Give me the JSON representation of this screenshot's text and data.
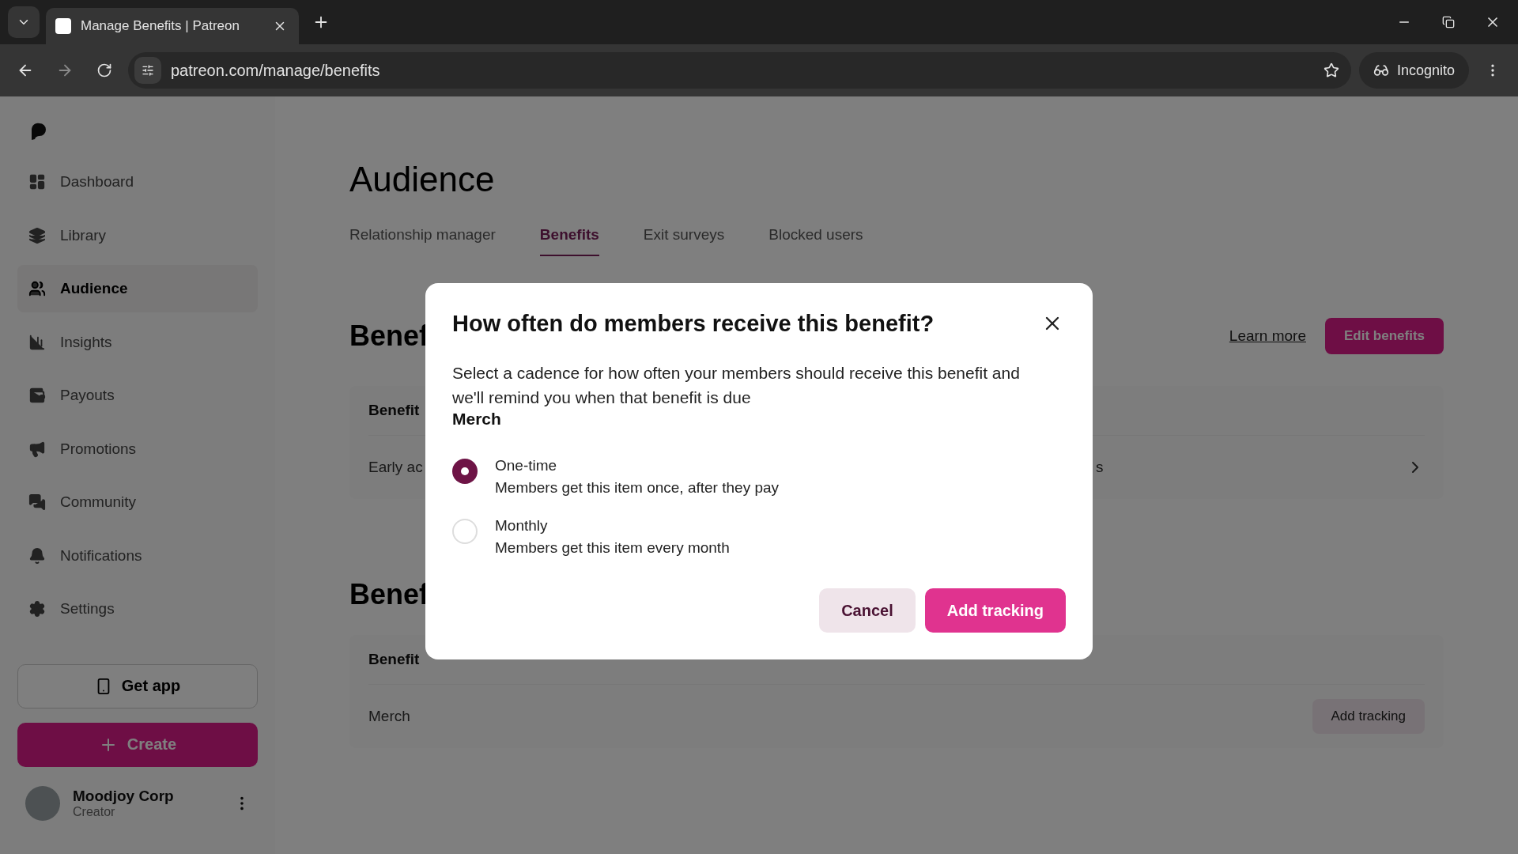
{
  "browser": {
    "tab_title": "Manage Benefits | Patreon",
    "url": "patreon.com/manage/benefits",
    "incognito_label": "Incognito"
  },
  "sidebar": {
    "items": [
      {
        "label": "Dashboard",
        "selected": false
      },
      {
        "label": "Library",
        "selected": false
      },
      {
        "label": "Audience",
        "selected": true
      },
      {
        "label": "Insights",
        "selected": false
      },
      {
        "label": "Payouts",
        "selected": false
      },
      {
        "label": "Promotions",
        "selected": false
      },
      {
        "label": "Community",
        "selected": false
      },
      {
        "label": "Notifications",
        "selected": false
      },
      {
        "label": "Settings",
        "selected": false
      }
    ],
    "get_app": "Get app",
    "create": "Create",
    "user": {
      "name": "Moodjoy Corp",
      "role": "Creator"
    }
  },
  "page": {
    "title": "Audience",
    "tabs": [
      {
        "label": "Relationship manager",
        "selected": false
      },
      {
        "label": "Benefits",
        "selected": true
      },
      {
        "label": "Exit surveys",
        "selected": false
      },
      {
        "label": "Blocked users",
        "selected": false
      }
    ],
    "section_1": {
      "heading": "Benef",
      "learn_more": "Learn more",
      "edit_button": "Edit benefits",
      "column_header": "Benefit",
      "row": {
        "column_1": "Early ac",
        "column_2": "s"
      }
    },
    "section_2": {
      "heading": "Benef",
      "column_header": "Benefit",
      "row": {
        "name": "Merch",
        "action": "Add tracking"
      }
    }
  },
  "dialog": {
    "title": "How often do members receive this benefit?",
    "description": "Select a cadence for how often your members should receive this benefit and we'll remind you when that benefit is due",
    "benefit_name": "Merch",
    "options": [
      {
        "label": "One-time",
        "description": "Members get this item once, after they pay",
        "selected": true
      },
      {
        "label": "Monthly",
        "description": "Members get this item every month",
        "selected": false
      }
    ],
    "cancel": "Cancel",
    "confirm": "Add tracking"
  }
}
